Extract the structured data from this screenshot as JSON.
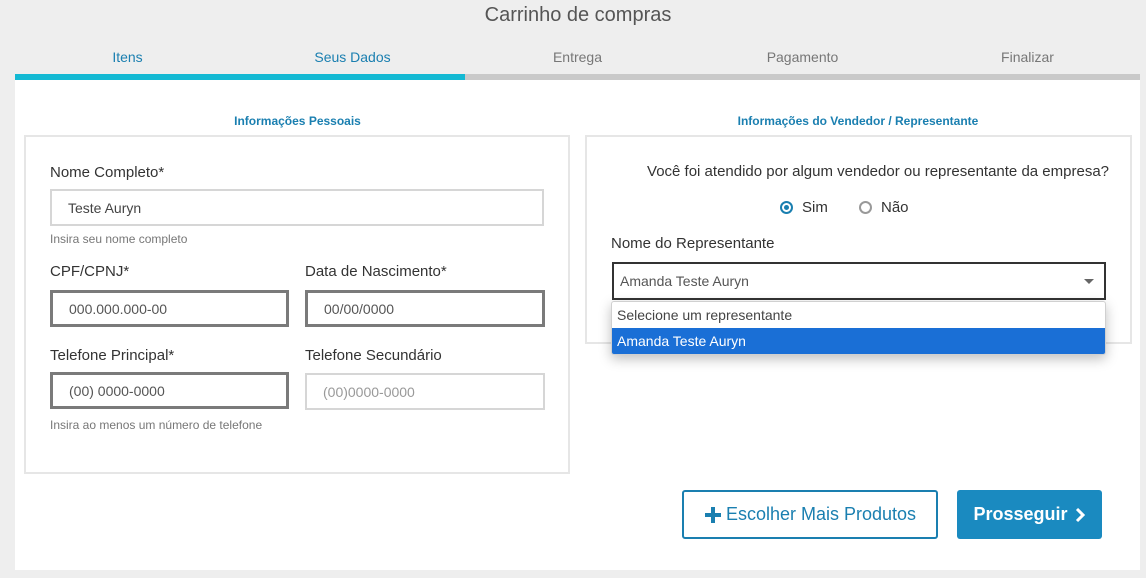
{
  "header": {
    "title": "Carrinho de compras"
  },
  "steps": [
    {
      "label": "Itens"
    },
    {
      "label": "Seus Dados"
    },
    {
      "label": "Entrega"
    },
    {
      "label": "Pagamento"
    },
    {
      "label": "Finalizar"
    }
  ],
  "progress": {
    "completed_steps": 2,
    "total_steps": 5,
    "color": "#13b9d3"
  },
  "personal": {
    "title": "Informações Pessoais",
    "name_label": "Nome Completo*",
    "name_value": "Teste Auryn",
    "name_hint": "Insira seu nome completo",
    "cpf_label": "CPF/CPNJ*",
    "cpf_placeholder": "000.000.000-00",
    "birth_label": "Data de Nascimento*",
    "birth_placeholder": "00/00/0000",
    "phone_label": "Telefone Principal*",
    "phone_placeholder": "(00) 0000-0000",
    "phone2_label": "Telefone Secundário",
    "phone2_placeholder": "(00)0000-0000",
    "phone_hint": "Insira ao menos um número de telefone"
  },
  "seller": {
    "title": "Informações do Vendedor / Representante",
    "question": "Você foi atendido por algum vendedor ou representante da empresa?",
    "option_yes": "Sim",
    "option_no": "Não",
    "selected_option": "Sim",
    "rep_label": "Nome do Representante",
    "rep_selected": "Amanda Teste Auryn",
    "options": [
      "Selecione um representante",
      "Amanda Teste Auryn"
    ]
  },
  "actions": {
    "more_products": "Escolher Mais Produtos",
    "proceed": "Prosseguir"
  },
  "colors": {
    "accent": "#1a7fb0",
    "primary_button": "#1a8ac0",
    "dropdown_highlight": "#1a6fd6"
  }
}
